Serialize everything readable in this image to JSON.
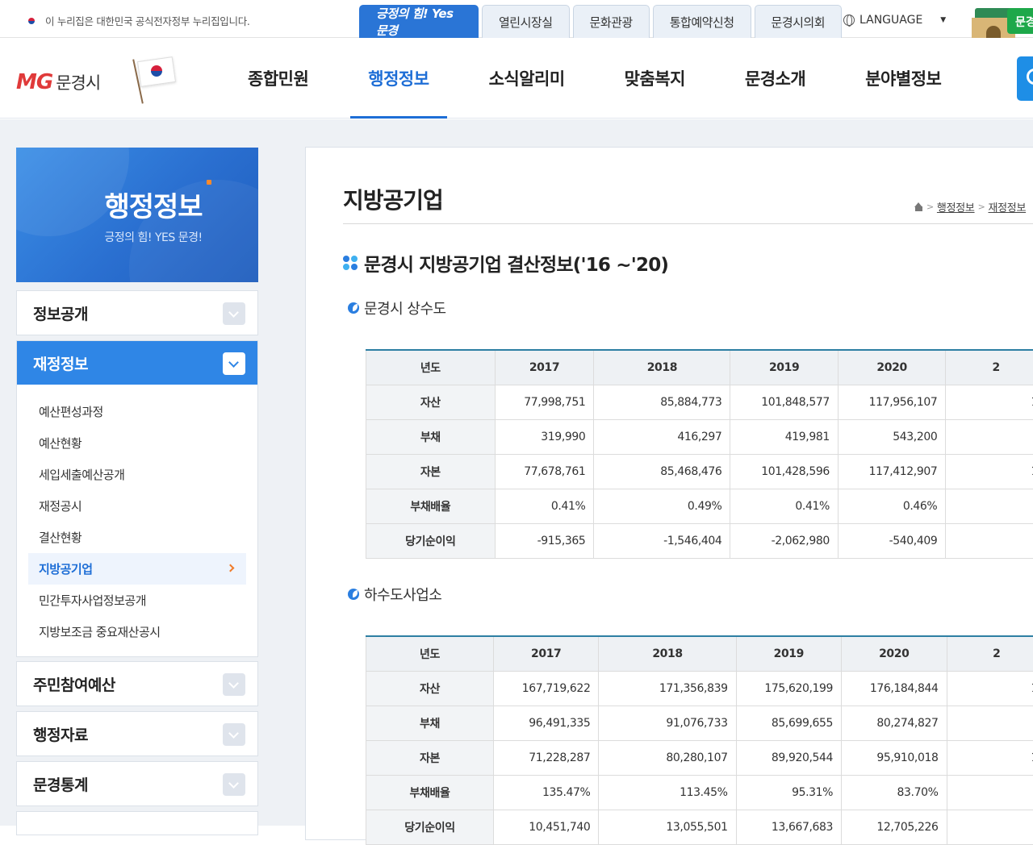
{
  "util": {
    "notice": "이 누리집은 대한민국 공식전자정부 누리집입니다.",
    "brand_tab": "긍정의 힘! Yes 문경",
    "tabs": [
      "열린시장실",
      "문화관광",
      "통합예약신청",
      "문경시의회"
    ],
    "language": "LANGUAGE",
    "gate_tag": "문경"
  },
  "header": {
    "logo_mg": "MG",
    "logo_city": "문경시",
    "gnb": [
      "종합민원",
      "행정정보",
      "소식알리미",
      "맞춤복지",
      "문경소개",
      "분야별정보"
    ],
    "gnb_active_index": 1
  },
  "sidebar": {
    "title": "행정정보",
    "slogan": "긍정의 힘! YES 문경!",
    "groups": [
      {
        "label": "정보공개",
        "open": false
      },
      {
        "label": "재정정보",
        "open": true
      },
      {
        "label": "주민참여예산",
        "open": false
      },
      {
        "label": "행정자료",
        "open": false
      },
      {
        "label": "문경통계",
        "open": false
      }
    ],
    "subitems": [
      "예산편성과정",
      "예산현황",
      "세입세출예산공개",
      "재정공시",
      "결산현황",
      "지방공기업",
      "민간투자사업정보공개",
      "지방보조금 중요재산공시"
    ],
    "active_subitem": "지방공기업"
  },
  "content": {
    "page_title": "지방공기업",
    "breadcrumb": [
      "행정정보",
      "재정정보"
    ],
    "section_title": "문경시 지방공기업 결산정보('16 ~'20)",
    "tables": [
      {
        "title": "문경시 상수도",
        "headers": [
          "년도",
          "2017",
          "2018",
          "2019",
          "2020",
          "2"
        ],
        "rows": [
          {
            "label": "자산",
            "values": [
              "77,998,751",
              "85,884,773",
              "101,848,577",
              "117,956,107",
              "1"
            ]
          },
          {
            "label": "부채",
            "values": [
              "319,990",
              "416,297",
              "419,981",
              "543,200",
              ""
            ]
          },
          {
            "label": "자본",
            "values": [
              "77,678,761",
              "85,468,476",
              "101,428,596",
              "117,412,907",
              "1"
            ]
          },
          {
            "label": "부채배율",
            "values": [
              "0.41%",
              "0.49%",
              "0.41%",
              "0.46%",
              ""
            ]
          },
          {
            "label": "당기순이익",
            "values": [
              "-915,365",
              "-1,546,404",
              "-2,062,980",
              "-540,409",
              ""
            ]
          }
        ]
      },
      {
        "title": "하수도사업소",
        "headers": [
          "년도",
          "2017",
          "2018",
          "2019",
          "2020",
          "2"
        ],
        "rows": [
          {
            "label": "자산",
            "values": [
              "167,719,622",
              "171,356,839",
              "175,620,199",
              "176,184,844",
              "1"
            ]
          },
          {
            "label": "부채",
            "values": [
              "96,491,335",
              "91,076,733",
              "85,699,655",
              "80,274,827",
              ""
            ]
          },
          {
            "label": "자본",
            "values": [
              "71,228,287",
              "80,280,107",
              "89,920,544",
              "95,910,018",
              "1"
            ]
          },
          {
            "label": "부채배율",
            "values": [
              "135.47%",
              "113.45%",
              "95.31%",
              "83.70%",
              ""
            ]
          },
          {
            "label": "당기순이익",
            "values": [
              "10,451,740",
              "13,055,501",
              "13,667,683",
              "12,705,226",
              ""
            ]
          }
        ]
      }
    ]
  },
  "colors": {
    "primary": "#1e6ed6",
    "side_hero": "#2a6fd0",
    "table_top": "#2d7fa3",
    "accent_orange": "#f07b2a"
  }
}
